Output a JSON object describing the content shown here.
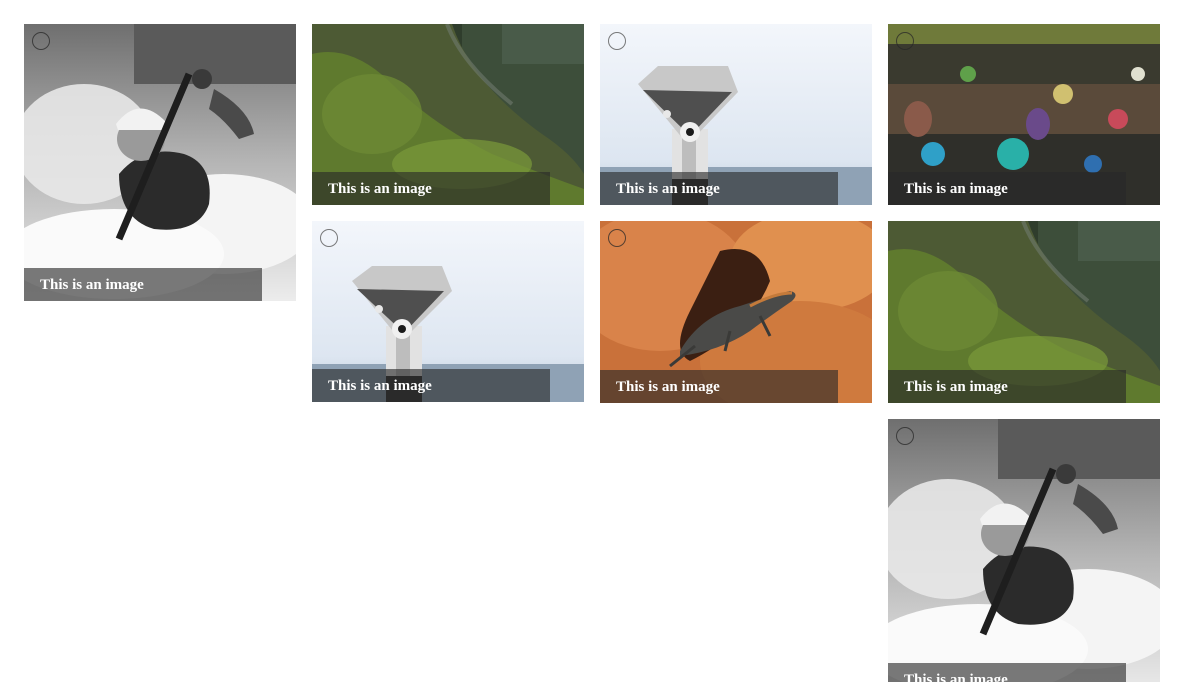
{
  "gallery": {
    "items": [
      {
        "caption": "This is an image",
        "photo": "kayak-whitewater-grayscale",
        "icon": "select-circle-icon"
      },
      {
        "caption": "This is an image",
        "photo": "mossy-tree-trunk",
        "icon": "select-circle-icon"
      },
      {
        "caption": "This is an image",
        "photo": "coin-binoculars-sea",
        "icon": "select-circle-icon"
      },
      {
        "caption": "This is an image",
        "photo": "floating-market-boats",
        "icon": "select-circle-icon"
      },
      {
        "caption": "This is an image",
        "photo": "coin-binoculars-sea",
        "icon": "select-circle-icon"
      },
      {
        "caption": "This is an image",
        "photo": "lizard-on-orange-rock",
        "icon": "select-circle-icon"
      },
      {
        "caption": "This is an image",
        "photo": "mossy-tree-trunk",
        "icon": "select-circle-icon"
      },
      {
        "caption": "This is an image",
        "photo": "kayak-whitewater-grayscale",
        "icon": "select-circle-icon"
      }
    ]
  },
  "colors": {
    "caption_background": "#282828",
    "caption_text": "#ffffff",
    "page_background": "#ffffff"
  }
}
